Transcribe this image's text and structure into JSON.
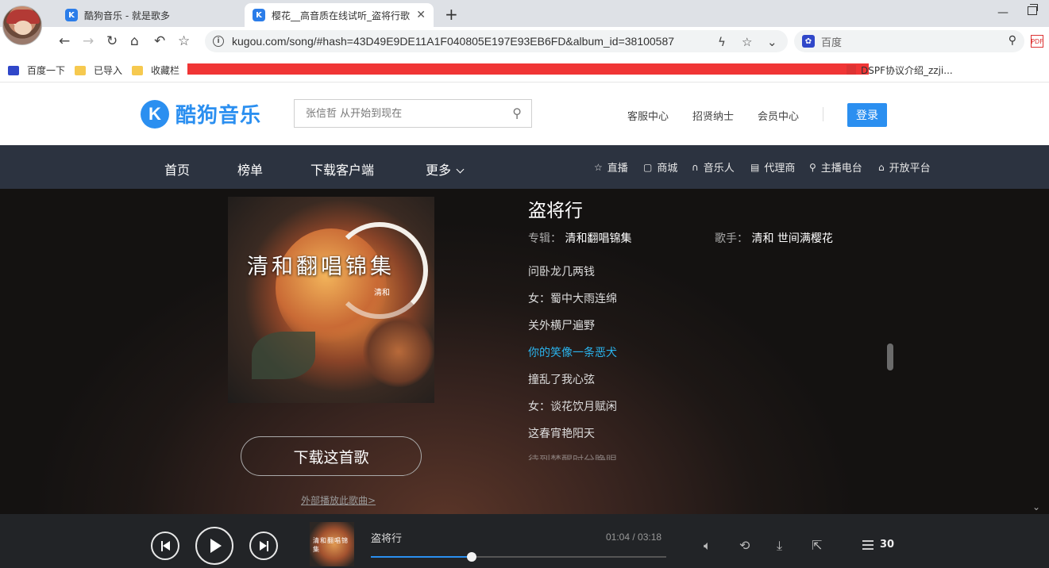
{
  "browser": {
    "tabs": [
      {
        "title": "酷狗音乐 - 就是歌多",
        "favicon": "K"
      },
      {
        "title": "樱花__高音质在线试听_盗将行歌",
        "favicon": "K",
        "close": "✕"
      }
    ],
    "new_tab": "+",
    "url": "kugou.com/song/#hash=43D49E9DE11A1F040805E197E93EB6FD&album_id=38100587",
    "search_placeholder": "百度",
    "bookmarks": [
      {
        "label": "百度一下",
        "icon": "baidu-paw-icon"
      },
      {
        "label": "已导入",
        "icon": "folder-icon"
      },
      {
        "label": "收藏栏",
        "icon": "folder-icon"
      }
    ],
    "bookmark_last": "DSPF协议介绍_zzji..."
  },
  "site": {
    "logo_letter": "K",
    "logo_text": "酷狗音乐",
    "search_placeholder": "张信哲 从开始到现在",
    "header_links": [
      "客服中心",
      "招贤纳士",
      "会员中心"
    ],
    "login": "登录",
    "nav_main": [
      "首页",
      "榜单",
      "下载客户端",
      "更多"
    ],
    "nav_sub": [
      {
        "icon": "star-icon",
        "glyph": "☆",
        "label": "直播"
      },
      {
        "icon": "shop-icon",
        "glyph": "▢",
        "label": "商城"
      },
      {
        "icon": "headphones-icon",
        "glyph": "∩",
        "label": "音乐人"
      },
      {
        "icon": "agent-icon",
        "glyph": "▤",
        "label": "代理商"
      },
      {
        "icon": "mic-icon",
        "glyph": "⚲",
        "label": "主播电台"
      },
      {
        "icon": "open-platform-icon",
        "glyph": "⌂",
        "label": "开放平台"
      }
    ]
  },
  "song": {
    "cover_title": "清和翻唱锦集",
    "cover_sign": "清和",
    "title": "盗将行",
    "album_label": "专辑：",
    "album": "清和翻唱锦集",
    "singer_label": "歌手：",
    "singer": "清和 世间满樱花",
    "download_button": "下载这首歌",
    "external_link": "外部播放此歌曲>",
    "lyrics": [
      "问卧龙几两钱",
      "女：蜀中大雨连绵",
      "关外横尸遍野",
      "你的笑像一条恶犬",
      "撞乱了我心弦",
      "女：谈花饮月赋闲",
      "这春宵艳阳天",
      "待到梦醒时分睁眼"
    ],
    "active_lyric_index": 3
  },
  "player": {
    "title": "盗将行",
    "mini_cover_text": "清和翻唱锦集",
    "current_time": "01:04",
    "total_time": "03:18",
    "progress_fraction": 0.341,
    "playlist_count": "30"
  },
  "colors": {
    "accent": "#2b8ff0",
    "active_lyric": "#2ab4ee",
    "nav_bg": "#2c3340",
    "player_bg": "#222427"
  }
}
